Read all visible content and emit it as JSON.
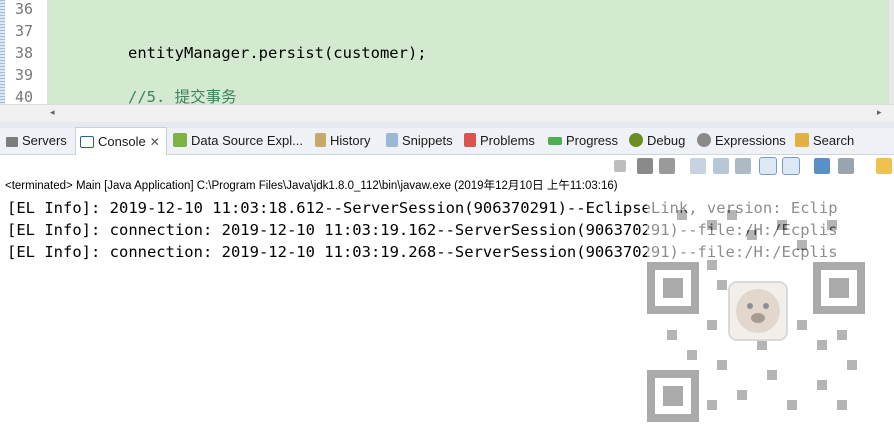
{
  "editor": {
    "line_numbers": [
      "36",
      "37",
      "38",
      "39",
      "40"
    ],
    "code_lines": [
      {
        "text": "",
        "comment": false
      },
      {
        "text": "",
        "comment": false
      },
      {
        "text": "entityManager.persist(customer);",
        "comment": false
      },
      {
        "text": "",
        "comment": false
      },
      {
        "text": "//5. 提交事务",
        "comment": true
      }
    ],
    "scroll_left_glyph": "◂",
    "scroll_right_glyph": "▸"
  },
  "tabs": [
    {
      "label": "Servers",
      "icon": "servers-icon",
      "active": false
    },
    {
      "label": "Console",
      "icon": "console-icon",
      "active": true,
      "close": "✕"
    },
    {
      "label": "Data Source Expl...",
      "icon": "data-source-icon",
      "active": false
    },
    {
      "label": "History",
      "icon": "history-icon",
      "active": false
    },
    {
      "label": "Snippets",
      "icon": "snippets-icon",
      "active": false
    },
    {
      "label": "Problems",
      "icon": "problems-icon",
      "active": false
    },
    {
      "label": "Progress",
      "icon": "progress-icon",
      "active": false
    },
    {
      "label": "Debug",
      "icon": "debug-icon",
      "active": false
    },
    {
      "label": "Expressions",
      "icon": "expressions-icon",
      "active": false
    },
    {
      "label": "Search",
      "icon": "search-icon",
      "active": false
    }
  ],
  "console_toolbar": [
    "terminate-icon",
    "remove-launch-icon",
    "remove-all-terminated-icon",
    "clear-console-icon",
    "scroll-lock-icon",
    "word-wrap-icon",
    "show-on-stdout-icon",
    "show-on-stderr-icon",
    "pin-console-icon",
    "display-selected-console-icon",
    "open-console-icon"
  ],
  "status_line": "<terminated> Main [Java Application] C:\\Program Files\\Java\\jdk1.8.0_112\\bin\\javaw.exe (2019年12月10日 上午11:03:16)",
  "output_lines": [
    "[EL Info]: 2019-12-10 11:03:18.612--ServerSession(906370291)--EclipseLink, version: Eclip",
    "[EL Info]: connection: 2019-12-10 11:03:19.162--ServerSession(906370291)--file:/H:/Ecplis",
    "[EL Info]: connection: 2019-12-10 11:03:19.268--ServerSession(906370291)--file:/H:/Ecplis"
  ],
  "colors": {
    "editor_highlight": "#d4ead0",
    "comment": "#3f7f5f",
    "line_number": "#787878",
    "tab_strip": "#eef1f5"
  }
}
